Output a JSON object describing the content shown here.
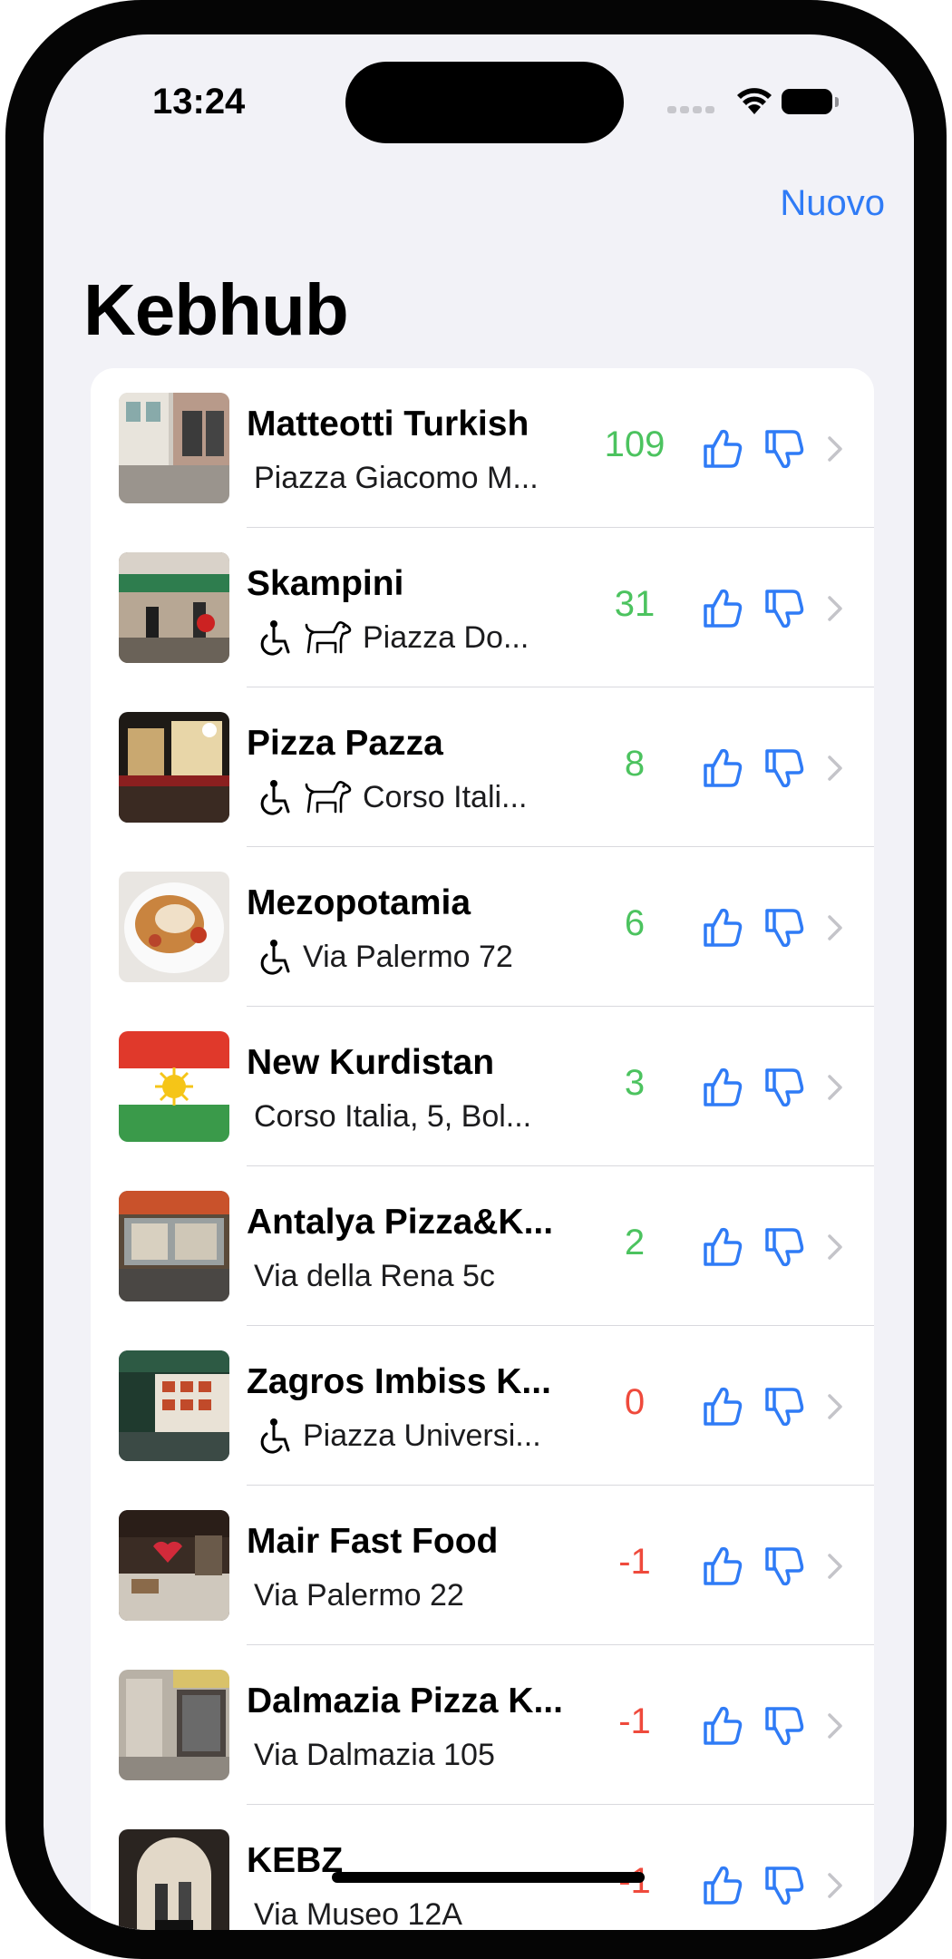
{
  "status_bar": {
    "time": "13:24"
  },
  "nav": {
    "new_button": "Nuovo",
    "title": "Kebhub"
  },
  "colors": {
    "accent": "#2f7bf6",
    "positive": "#4cc35f",
    "negative": "#ef4a3c"
  },
  "restaurants": [
    {
      "name": "Matteotti Turkish",
      "address": "Piazza Giacomo M...",
      "score": "109",
      "score_status": "positive",
      "wheelchair": false,
      "dog": false
    },
    {
      "name": "Skampini",
      "address": "Piazza Do...",
      "score": "31",
      "score_status": "positive",
      "wheelchair": true,
      "dog": true
    },
    {
      "name": "Pizza Pazza",
      "address": "Corso Itali...",
      "score": "8",
      "score_status": "positive",
      "wheelchair": true,
      "dog": true
    },
    {
      "name": "Mezopotamia",
      "address": "Via Palermo 72",
      "score": "6",
      "score_status": "positive",
      "wheelchair": true,
      "dog": false
    },
    {
      "name": "New Kurdistan",
      "address": "Corso Italia, 5, Bol...",
      "score": "3",
      "score_status": "positive",
      "wheelchair": false,
      "dog": false
    },
    {
      "name": "Antalya Pizza&K...",
      "address": "Via della Rena 5c",
      "score": "2",
      "score_status": "positive",
      "wheelchair": false,
      "dog": false
    },
    {
      "name": "Zagros Imbiss K...",
      "address": "Piazza Universi...",
      "score": "0",
      "score_status": "negative",
      "wheelchair": true,
      "dog": false
    },
    {
      "name": "Mair Fast Food",
      "address": "Via Palermo 22",
      "score": "-1",
      "score_status": "negative",
      "wheelchair": false,
      "dog": false
    },
    {
      "name": "Dalmazia Pizza K...",
      "address": "Via Dalmazia 105",
      "score": "-1",
      "score_status": "negative",
      "wheelchair": false,
      "dog": false
    },
    {
      "name": "KEBZ",
      "address": "Via Museo 12A",
      "score": "-1",
      "score_status": "negative",
      "wheelchair": false,
      "dog": false
    }
  ]
}
